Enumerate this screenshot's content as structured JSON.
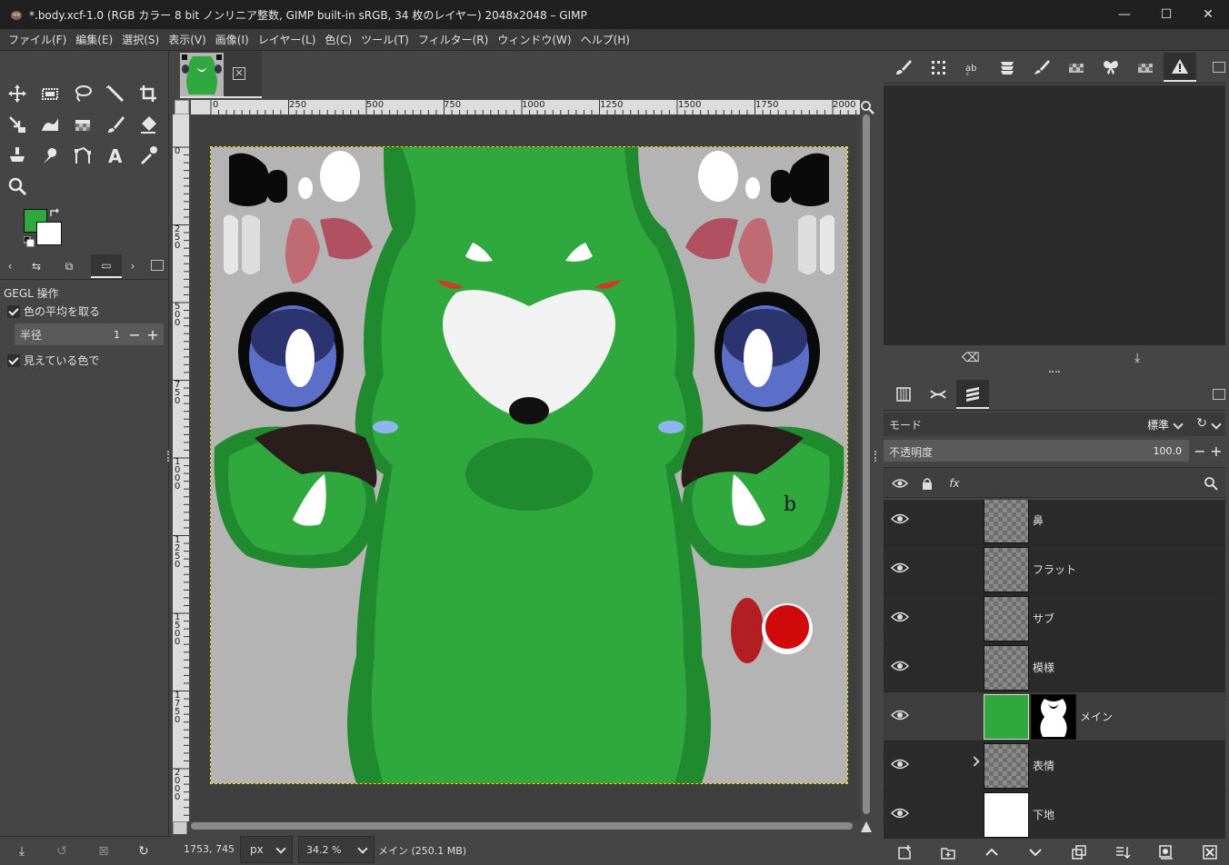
{
  "window": {
    "title": "*.body.xcf-1.0 (RGB カラー 8 bit ノンリニア整数, GIMP built-in sRGB, 34 枚のレイヤー) 2048x2048 – GIMP",
    "minimize": "—",
    "maximize": "☐",
    "close": "✕"
  },
  "menu": [
    "ファイル(F)",
    "編集(E)",
    "選択(S)",
    "表示(V)",
    "画像(I)",
    "レイヤー(L)",
    "色(C)",
    "ツール(T)",
    "フィルター(R)",
    "ウィンドウ(W)",
    "ヘルプ(H)"
  ],
  "colors": {
    "foreground": "#2fa83d",
    "background": "#ffffff",
    "accent": "#e0e0e0"
  },
  "tools": [
    "move-tool-icon",
    "rect-select-tool-icon",
    "lasso-tool-icon",
    "fuzzy-select-tool-icon",
    "crop-tool-icon",
    "transform-tool-icon",
    "warp-tool-icon",
    "bucket-fill-tool-icon",
    "paintbrush-tool-icon",
    "eraser-tool-icon",
    "clone-tool-icon",
    "smudge-tool-icon",
    "paths-tool-icon",
    "text-tool-icon",
    "color-picker-tool-icon",
    "zoom-tool-icon"
  ],
  "tool_options": {
    "heading": "GEGL 操作",
    "average_label": "色の平均を取る",
    "radius_label": "半径",
    "radius_value": "1",
    "visible_label": "見えている色で"
  },
  "ruler": {
    "h_labels": [
      "0",
      "250",
      "500",
      "750",
      "1000",
      "1250",
      "1500",
      "1750",
      "2000"
    ],
    "v_labels": [
      "0",
      "250",
      "500",
      "750",
      "1000",
      "1250",
      "1500",
      "1750",
      "2000"
    ]
  },
  "status": {
    "coords": "1753, 745",
    "unit": "px",
    "zoom": "34.2 %",
    "message": "メイン (250.1 MB)"
  },
  "layers_panel": {
    "mode_label": "モード",
    "mode_value": "標準",
    "opacity_label": "不透明度",
    "opacity_value": "100.0",
    "fx_label": "fx",
    "layers": [
      {
        "name": "鼻",
        "selected": false,
        "has_mask": false,
        "expandable": false
      },
      {
        "name": "フラット",
        "selected": false,
        "has_mask": false,
        "expandable": false
      },
      {
        "name": "サブ",
        "selected": false,
        "has_mask": false,
        "expandable": false
      },
      {
        "name": "模様",
        "selected": false,
        "has_mask": false,
        "expandable": false
      },
      {
        "name": "メイン",
        "selected": true,
        "has_mask": true,
        "expandable": false
      },
      {
        "name": "表情",
        "selected": false,
        "has_mask": false,
        "expandable": true
      },
      {
        "name": "下地",
        "selected": false,
        "has_mask": false,
        "expandable": false
      }
    ]
  },
  "canvas_note": "b"
}
